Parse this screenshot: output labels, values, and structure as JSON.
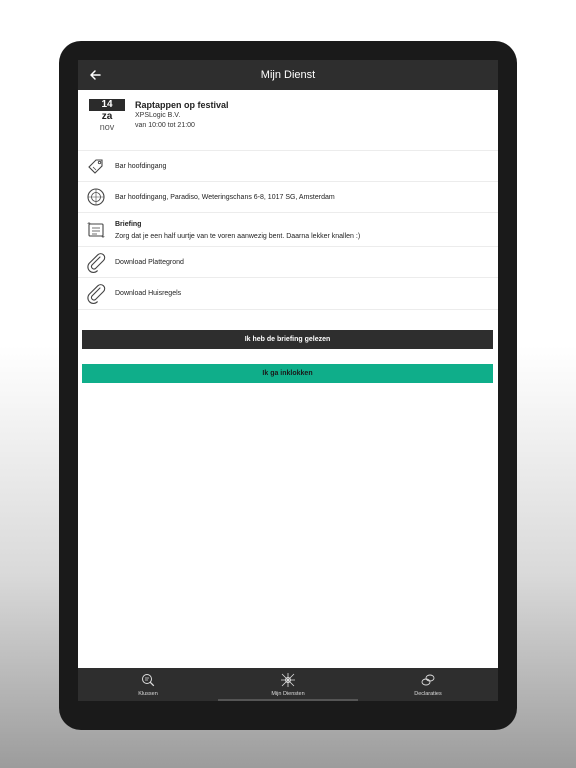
{
  "appbar": {
    "title": "Mijn Dienst"
  },
  "shift": {
    "day": "14",
    "weekday": "za",
    "month": "nov",
    "title": "Raptappen op festival",
    "company": "XPSLogic B.V.",
    "time": "van 10:00 tot 21:00"
  },
  "details": {
    "location_name": "Bar hoofdingang",
    "address": "Bar hoofdingang, Paradiso, Weteringschans 6-8, 1017 SG, Amsterdam",
    "briefing_label": "Briefing",
    "briefing_text": "Zorg dat je een half uurtje van te voren aanwezig bent. Daarna lekker knallen :)",
    "download_1": "Download Plattegrond",
    "download_2": "Download Huisregels"
  },
  "actions": {
    "read_briefing": "Ik heb de briefing gelezen",
    "check_in": "Ik ga inklokken"
  },
  "bottom_nav": {
    "items": [
      {
        "label": "Klussen",
        "icon": "search-list-icon"
      },
      {
        "label": "Mijn Diensten",
        "icon": "shifts-icon"
      },
      {
        "label": "Declaraties",
        "icon": "coins-icon"
      }
    ]
  },
  "colors": {
    "dark": "#2e2e2e",
    "accent": "#0fae8a"
  }
}
